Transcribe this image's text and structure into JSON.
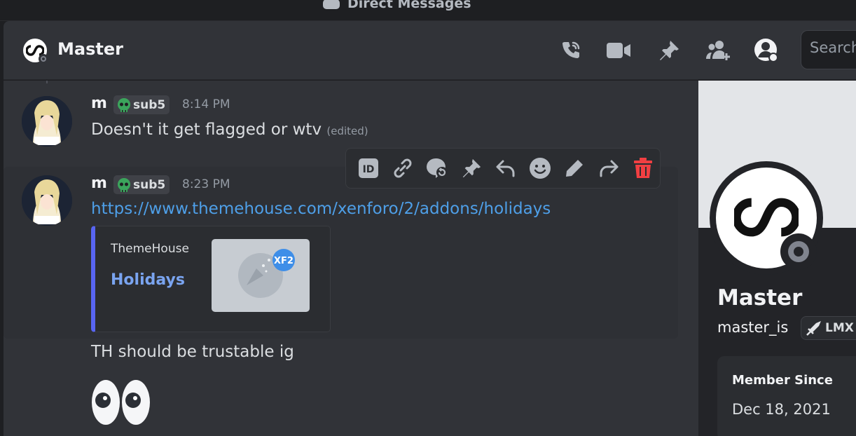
{
  "topbar": {
    "title": "Direct Messages"
  },
  "header": {
    "name": "Master",
    "icons": [
      "voice-call-icon",
      "video-call-icon",
      "pinned-messages-icon",
      "add-friends-icon",
      "user-profile-icon"
    ],
    "search_placeholder": "Search"
  },
  "messages": [
    {
      "username": "m",
      "tag": "sub5",
      "time": "8:14 PM",
      "text": "Doesn't it get flagged or wtv",
      "edited": "(edited)"
    },
    {
      "username": "m",
      "tag": "sub5",
      "time": "8:23 PM",
      "link": "https://www.themehouse.com/xenforo/2/addons/holidays",
      "embed": {
        "provider": "ThemeHouse",
        "title": "Holidays",
        "thumb_badge": "XF2"
      }
    },
    {
      "text": "TH should be trustable ig"
    },
    {
      "emoji": "👀"
    }
  ],
  "toolbar": {
    "id_label": "ID",
    "icons": [
      "copy-id-icon",
      "copy-link-icon",
      "create-thread-icon",
      "pin-icon",
      "reply-icon",
      "add-reaction-icon",
      "edit-icon",
      "forward-icon",
      "delete-icon"
    ]
  },
  "profile": {
    "display_name": "Master",
    "username": "master_is",
    "badge": "LMX",
    "member_since_label": "Member Since",
    "member_since": "Dec 18, 2021"
  },
  "colors": {
    "accent": "#5865f2",
    "link": "#4e9fe8",
    "delete": "#f23f42",
    "tag_skull": "#3ba55c"
  }
}
